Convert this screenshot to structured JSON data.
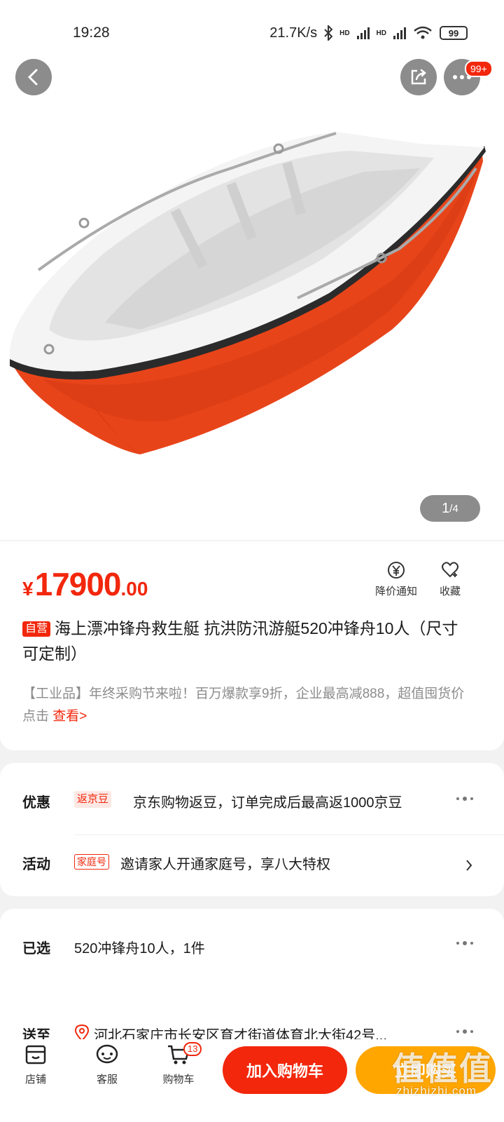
{
  "status_bar": {
    "time": "19:28",
    "network_speed": "21.7K/s",
    "hd1": "HD",
    "hd2": "HD",
    "battery": "99"
  },
  "header": {
    "back_icon": "chevron-left-icon",
    "share_icon": "share-icon",
    "more_icon": "more-dots-icon",
    "message_badge": "99+"
  },
  "gallery": {
    "current": "1",
    "total": "/4"
  },
  "product": {
    "price_symbol": "¥",
    "price_integer": "17900",
    "price_decimal": ".00",
    "price_alert_label": "降价通知",
    "favorite_label": "收藏",
    "self_operated_tag": "自营",
    "title": "海上漂冲锋舟救生艇 抗洪防汛游艇520冲锋舟10人（尺寸可定制）",
    "promo_text": "【工业品】年终采购节来啦！百万爆款享9折，企业最高减888，超值囤货价点击",
    "promo_link": "查看>"
  },
  "offers": {
    "discount_label": "优惠",
    "discount_tag": "返京豆",
    "discount_text": "京东购物返豆，订单完成后最高返1000京豆",
    "activity_label": "活动",
    "activity_tag": "家庭号",
    "activity_text": "邀请家人开通家庭号，享八大特权"
  },
  "selection": {
    "selected_label": "已选",
    "selected_value": "520冲锋舟10人，1件",
    "ship_to_label": "送至",
    "address": "河北石家庄市长安区育才街道体育北大街42号..."
  },
  "bottom_nav": {
    "store_label": "店铺",
    "service_label": "客服",
    "cart_label": "购物车",
    "cart_count": "13",
    "add_to_cart": "加入购物车",
    "buy_now": "立即购买"
  },
  "watermark": {
    "main": "值值值",
    "sub": "zhizhizhi.com"
  },
  "colors": {
    "accent": "#f2270c",
    "buy": "#ffa600"
  }
}
